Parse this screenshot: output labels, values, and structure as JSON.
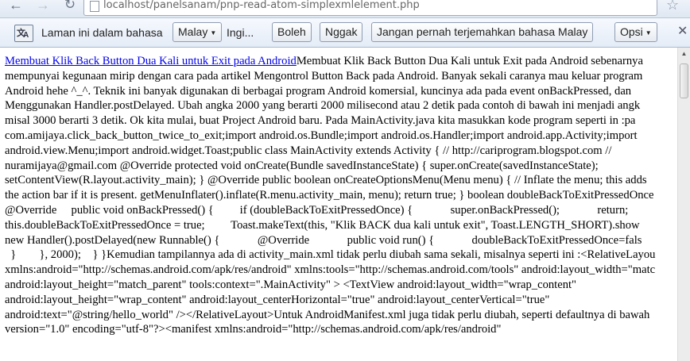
{
  "browser": {
    "url": "localhost/panelsanam/pnp-read-atom-simplexmlelement.php",
    "icons": {
      "back": "back-arrow-icon",
      "forward": "forward-arrow-icon",
      "reload": "reload-icon",
      "page": "page-icon",
      "bookmark": "star-icon"
    }
  },
  "translate_bar": {
    "message": "Laman ini dalam bahasa",
    "language_select": "Malay",
    "target_text": "Ingi...",
    "yes_label": "Boleh",
    "no_label": "Nggak",
    "never_label": "Jangan pernah terjemahkan bahasa Malay",
    "options_label": "Opsi",
    "icon": "translate-icon",
    "close_icon": "close-icon"
  },
  "article": {
    "link_text": "Membuat Klik Back Button Dua Kali untuk Exit pada Android",
    "lines": [
      "Membuat Klik Back Button Dua Kali untuk Exit pada Android sebenarnya",
      "mempunyai kegunaan mirip dengan cara pada artikel Mengontrol Button Back pada Android. Banyak sekali caranya mau keluar program",
      "Android hehe ^_^. Teknik ini banyak digunakan di berbagai program Android komersial, kuncinya ada pada event onBackPressed, dan",
      "Menggunakan Handler.postDelayed. Ubah angka 2000 yang berarti 2000 milisecond atau 2 detik pada contoh di bawah ini menjadi angk",
      "misal 3000 berarti 3 detik. Ok kita mulai, buat Project Android baru. Pada MainActivity.java kita masukkan kode program seperti in :pa",
      "com.amijaya.click_back_button_twice_to_exit;import android.os.Bundle;import android.os.Handler;import android.app.Activity;import",
      "android.view.Menu;import android.widget.Toast;public class MainActivity extends Activity { // http://cariprogram.blogspot.com //",
      "nuramijaya@gmail.com @Override protected void onCreate(Bundle savedInstanceState) { super.onCreate(savedInstanceState);",
      "setContentView(R.layout.activity_main); } @Override public boolean onCreateOptionsMenu(Menu menu) { // Inflate the menu; this adds",
      "the action bar if it is present. getMenuInflater().inflate(R.menu.activity_main, menu); return true; } boolean doubleBackToExitPressedOnce",
      "@Override     public void onBackPressed() {         if (doubleBackToExitPressedOnce) {             super.onBackPressed();             return;",
      "this.doubleBackToExitPressedOnce = true;         Toast.makeText(this, \"Klik BACK dua kali untuk exit\", Toast.LENGTH_SHORT).show",
      "new Handler().postDelayed(new Runnable() {             @Override             public void run() {             doubleBackToExitPressedOnce=fals",
      "  }        }, 2000);    } }Kemudian tampilannya ada di activity_main.xml tidak perlu diubah sama sekali, misalnya seperti ini :<RelativeLayou",
      "xmlns:android=\"http://schemas.android.com/apk/res/android\" xmlns:tools=\"http://schemas.android.com/tools\" android:layout_width=\"matc",
      "android:layout_height=\"match_parent\" tools:context=\".MainActivity\" > <TextView android:layout_width=\"wrap_content\"",
      "android:layout_height=\"wrap_content\" android:layout_centerHorizontal=\"true\" android:layout_centerVertical=\"true\"",
      "android:text=\"@string/hello_world\" /></RelativeLayout>Untuk AndroidManifest.xml juga tidak perlu diubah, seperti defaultnya di bawah",
      "version=\"1.0\" encoding=\"utf-8\"?><manifest xmlns:android=\"http://schemas.android.com/apk/res/android\""
    ]
  }
}
